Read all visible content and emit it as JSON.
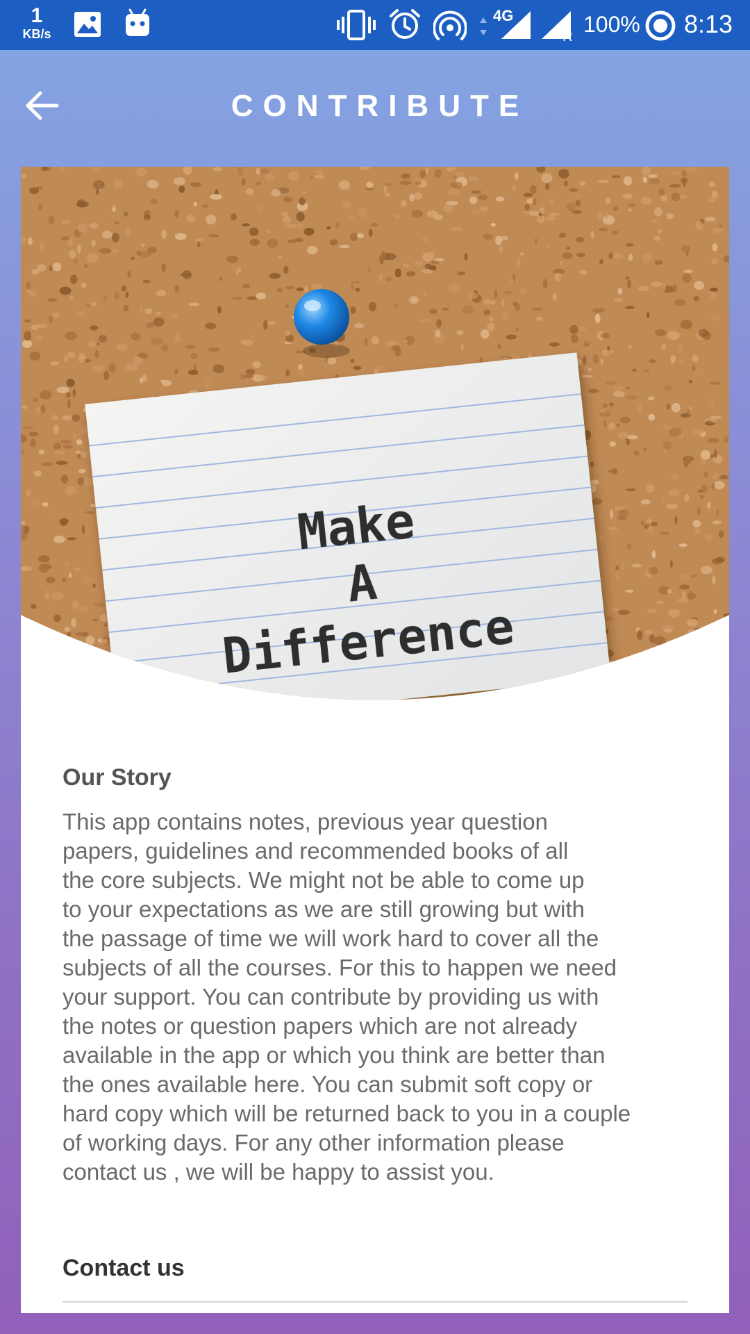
{
  "status_bar": {
    "net_speed_value": "1",
    "net_speed_unit": "KB/s",
    "network_type": "4G",
    "roaming_label": "R",
    "battery": "100%",
    "time": "8:13",
    "icons": [
      "image-icon",
      "android-icon",
      "vibrate-icon",
      "alarm-icon",
      "hotspot-icon",
      "data-arrows-icon",
      "signal-icon",
      "signal-roaming-icon",
      "battery-ring-icon"
    ]
  },
  "app_bar": {
    "title": "CONTRIBUTE",
    "back_icon": "arrow-left-icon"
  },
  "hero": {
    "note_line_1": "Make",
    "note_line_2": "A",
    "note_line_3": "Difference",
    "pin_color": "#1e88e5",
    "cork_color": "#c08a55"
  },
  "story": {
    "title": "Our Story",
    "lines": [
      "This app contains notes, previous year question",
      "papers, guidelines and recommended books of all",
      "the core subjects. We might not be able to come up",
      "to your expectations as we are still growing but with",
      "the passage of time we will work hard to cover all the",
      "subjects of all the courses. For this to happen we need",
      "your support. You can contribute by providing us with",
      "the notes or question papers which are not already",
      "available in the app or which you think are better than",
      "the ones available here. You can submit soft copy or",
      "hard copy which will be returned back to you in a couple",
      "of working days. For any other information please",
      "contact us , we will be happy to assist you."
    ]
  },
  "contact": {
    "title": "Contact us"
  },
  "colors": {
    "status_bar": "#1c5ec2",
    "gradient_top": "#82a6e2",
    "gradient_bottom": "#9160bb"
  }
}
